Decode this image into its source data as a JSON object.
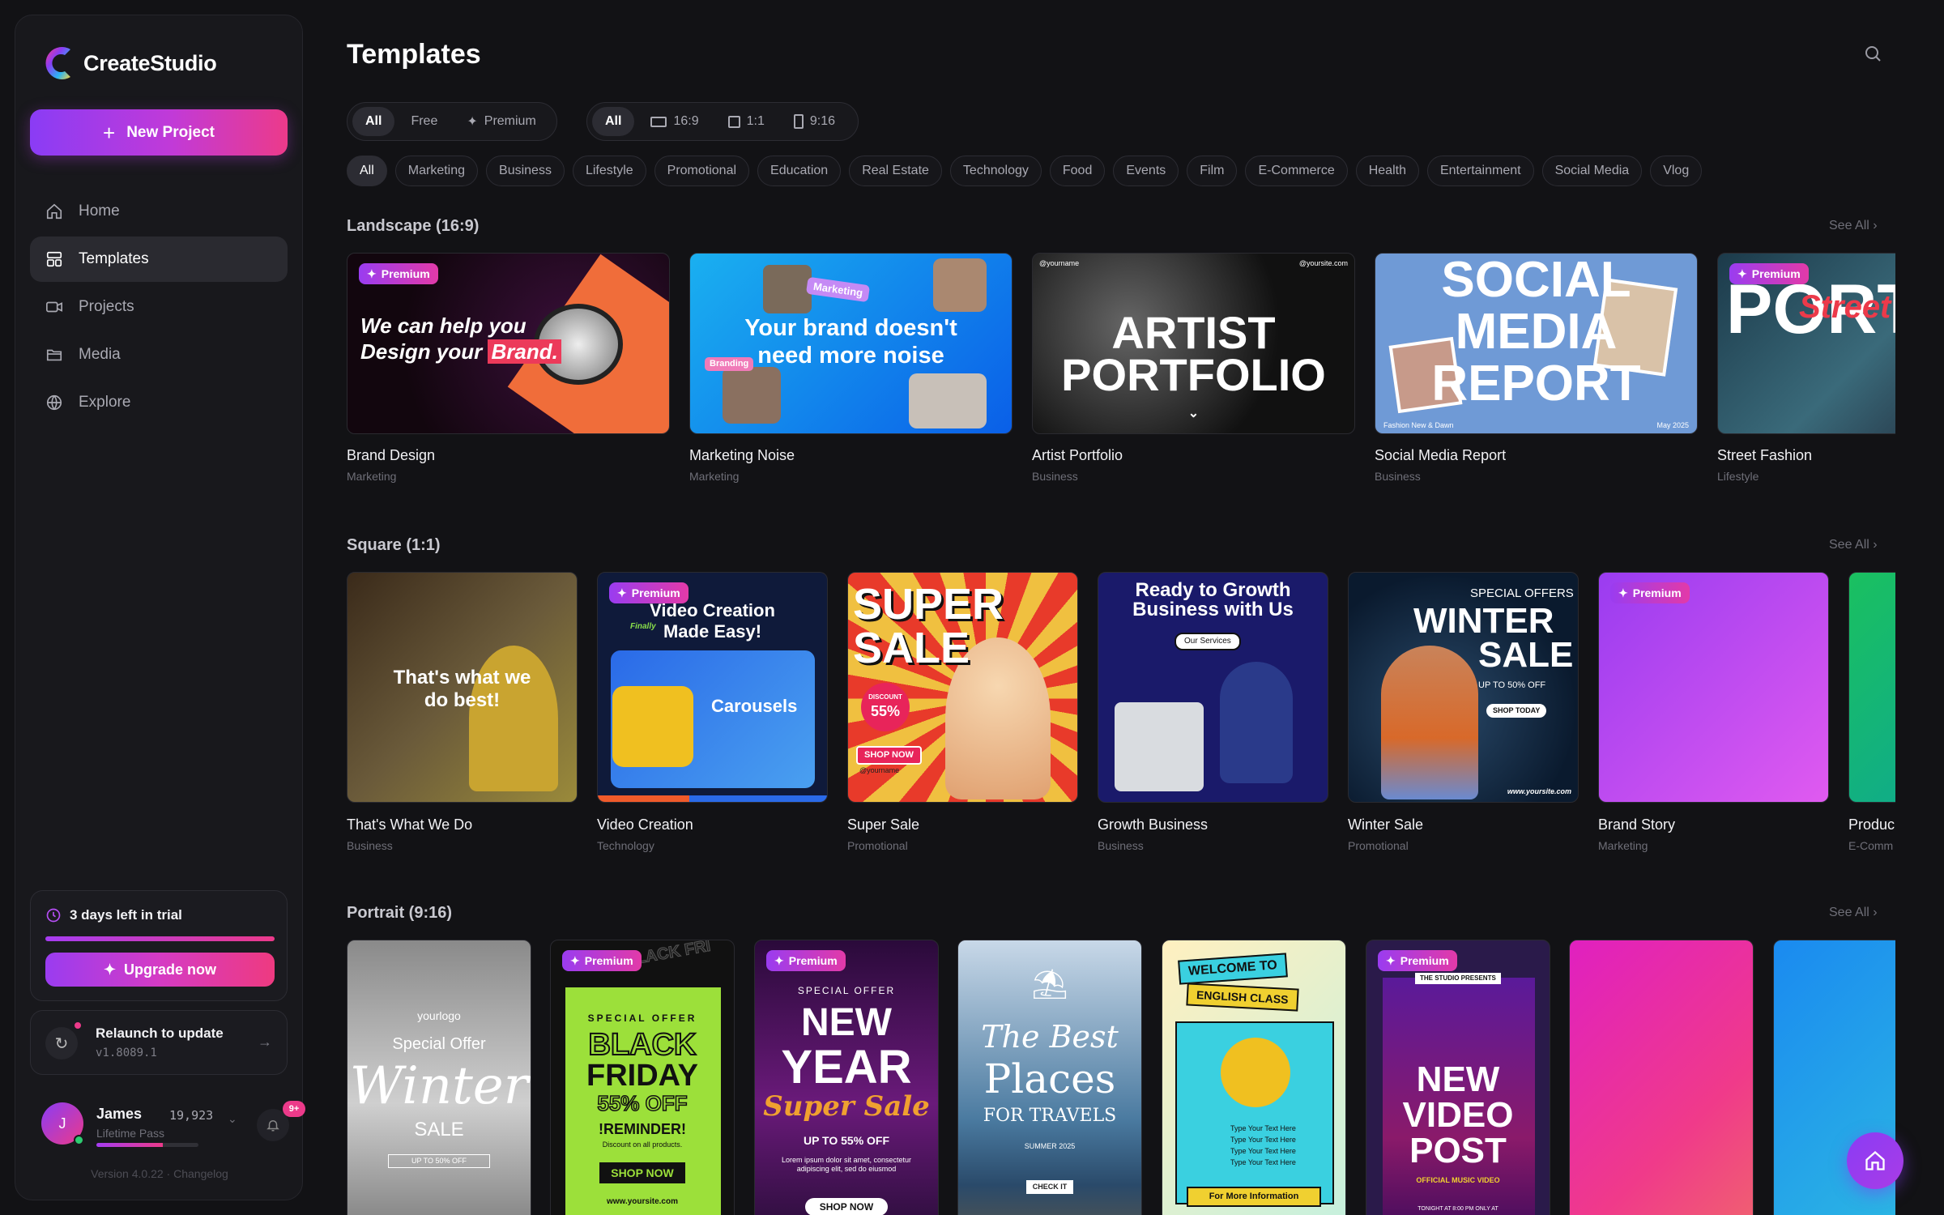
{
  "app": {
    "name": "CreateStudio",
    "new_project": "New Project",
    "version": "Version 4.0.22",
    "sep": "·",
    "changelog": "Changelog"
  },
  "nav": [
    {
      "label": "Home",
      "icon": "home-icon"
    },
    {
      "label": "Templates",
      "icon": "templates-icon",
      "active": true
    },
    {
      "label": "Projects",
      "icon": "projects-icon"
    },
    {
      "label": "Media",
      "icon": "folder-icon"
    },
    {
      "label": "Explore",
      "icon": "globe-icon"
    }
  ],
  "trial": {
    "text": "3 days left in trial",
    "upgrade": "Upgrade now",
    "progress": 1.0
  },
  "relaunch": {
    "title": "Relaunch to update",
    "version": "v1.8089.1"
  },
  "user": {
    "initial": "J",
    "name": "James",
    "points": "19,923",
    "plan": "Lifetime Pass",
    "xp_progress": 0.65,
    "notifications": "9+"
  },
  "page": {
    "title": "Templates"
  },
  "filters": {
    "tier": [
      {
        "label": "All",
        "active": true
      },
      {
        "label": "Free"
      },
      {
        "label": "Premium",
        "icon": "sparkle-icon"
      }
    ],
    "ratio": [
      {
        "label": "All",
        "active": true
      },
      {
        "label": "16:9",
        "icon": "landscape-icon"
      },
      {
        "label": "1:1",
        "icon": "square-icon"
      },
      {
        "label": "9:16",
        "icon": "portrait-icon"
      }
    ],
    "categories": [
      "All",
      "Marketing",
      "Business",
      "Lifestyle",
      "Promotional",
      "Education",
      "Real Estate",
      "Technology",
      "Food",
      "Events",
      "Film",
      "E-Commerce",
      "Health",
      "Entertainment",
      "Social Media",
      "Vlog"
    ]
  },
  "sections": {
    "landscape": {
      "title": "Landscape (16:9)",
      "see_all": "See All"
    },
    "square": {
      "title": "Square (1:1)",
      "see_all": "See All"
    },
    "portrait": {
      "title": "Portrait (9:16)",
      "see_all": "See All"
    }
  },
  "premium_label": "Premium",
  "landscape": [
    {
      "name": "Brand Design",
      "category": "Marketing",
      "premium": true,
      "t1": "We can help you",
      "t2": "Design your",
      "t3": "Brand."
    },
    {
      "name": "Marketing Noise",
      "category": "Marketing",
      "premium": false,
      "t1": "Your brand doesn't",
      "t2": "need more noise",
      "tag1": "Marketing",
      "tag2": "Branding"
    },
    {
      "name": "Artist Portfolio",
      "category": "Business",
      "premium": false,
      "t1": "ARTIST",
      "t2": "PORTFOLIO",
      "h1": "@yourname",
      "h2": "@yoursite.com"
    },
    {
      "name": "Social Media Report",
      "category": "Business",
      "premium": false,
      "t1": "SOCIAL",
      "t2": "MEDIA",
      "t3": "REPORT",
      "f1": "Fashion New & Dawn",
      "f2": "May 2025"
    },
    {
      "name": "Street Fashion",
      "category": "Lifestyle",
      "premium": true,
      "t1": "PORTF",
      "t2": "Street F"
    }
  ],
  "square": [
    {
      "name": "That's What We Do",
      "category": "Business",
      "premium": false,
      "t1": "That's what we",
      "t2": "do best!"
    },
    {
      "name": "Video Creation",
      "category": "Technology",
      "premium": true,
      "t1": "Video Creation",
      "t2": "Made Easy!",
      "t3": "Carousels",
      "t4": "Finally"
    },
    {
      "name": "Super Sale",
      "category": "Promotional",
      "premium": false,
      "t1": "SUPER",
      "t2": "SALE",
      "t3": "DISCOUNT",
      "t4": "55%",
      "t5": "SHOP NOW",
      "t6": "@yourname"
    },
    {
      "name": "Growth Business",
      "category": "Business",
      "premium": false,
      "t1": "Ready to Growth",
      "t2": "Business with Us",
      "t3": "Our Services"
    },
    {
      "name": "Winter Sale",
      "category": "Promotional",
      "premium": false,
      "t1": "SPECIAL OFFERS",
      "t2": "WINTER",
      "t3": "SALE",
      "t4": "UP TO 50% OFF",
      "t5": "SHOP TODAY",
      "t6": "www.yoursite.com"
    },
    {
      "name": "Brand Story",
      "category": "Marketing",
      "premium": true
    },
    {
      "name": "Produc",
      "category": "E-Comm",
      "premium": false
    }
  ],
  "portrait": [
    {
      "premium": false,
      "t1": "yourlogo",
      "t2": "Special Offer",
      "t3": "Winter",
      "t4": "SALE",
      "t5": "UP TO 50% OFF"
    },
    {
      "premium": true,
      "t1": "SPECIAL OFFER",
      "t2": "BLACK",
      "t3": "FRIDAY",
      "t4": "55% OFF",
      "t5": "!REMINDER!",
      "t6": "Discount on all products.",
      "t7": "SHOP NOW",
      "t8": "www.yoursite.com",
      "t9": "BLACK FRI"
    },
    {
      "premium": true,
      "t1": "SPECIAL OFFER",
      "t2": "NEW",
      "t3": "YEAR",
      "t4": "Super Sale",
      "t5": "UP TO 55% OFF",
      "t6": "Lorem ipsum dolor sit amet, consectetur adipiscing elit, sed do eiusmod",
      "t7": "SHOP NOW"
    },
    {
      "premium": false,
      "t1": "The Best",
      "t2": "Places",
      "t3": "FOR TRAVELS",
      "t4": "SUMMER 2025",
      "t5": "CHECK IT"
    },
    {
      "premium": false,
      "t1": "WELCOME TO",
      "t2": "ENGLISH CLASS",
      "t3": "Type Your Text Here",
      "t4": "For More Information"
    },
    {
      "premium": true,
      "t1": "THE STUDIO PRESENTS",
      "t2": "NEW",
      "t3": "VIDEO",
      "t4": "POST",
      "t5": "OFFICIAL MUSIC VIDEO",
      "t6": "TONIGHT AT 8:00 PM ONLY AT"
    },
    {
      "premium": false
    },
    {
      "premium": false
    }
  ],
  "colors": {
    "accent_start": "#8a3cf5",
    "accent_end": "#ec3a8a",
    "background": "#121215",
    "sidebar": "#18181c"
  }
}
